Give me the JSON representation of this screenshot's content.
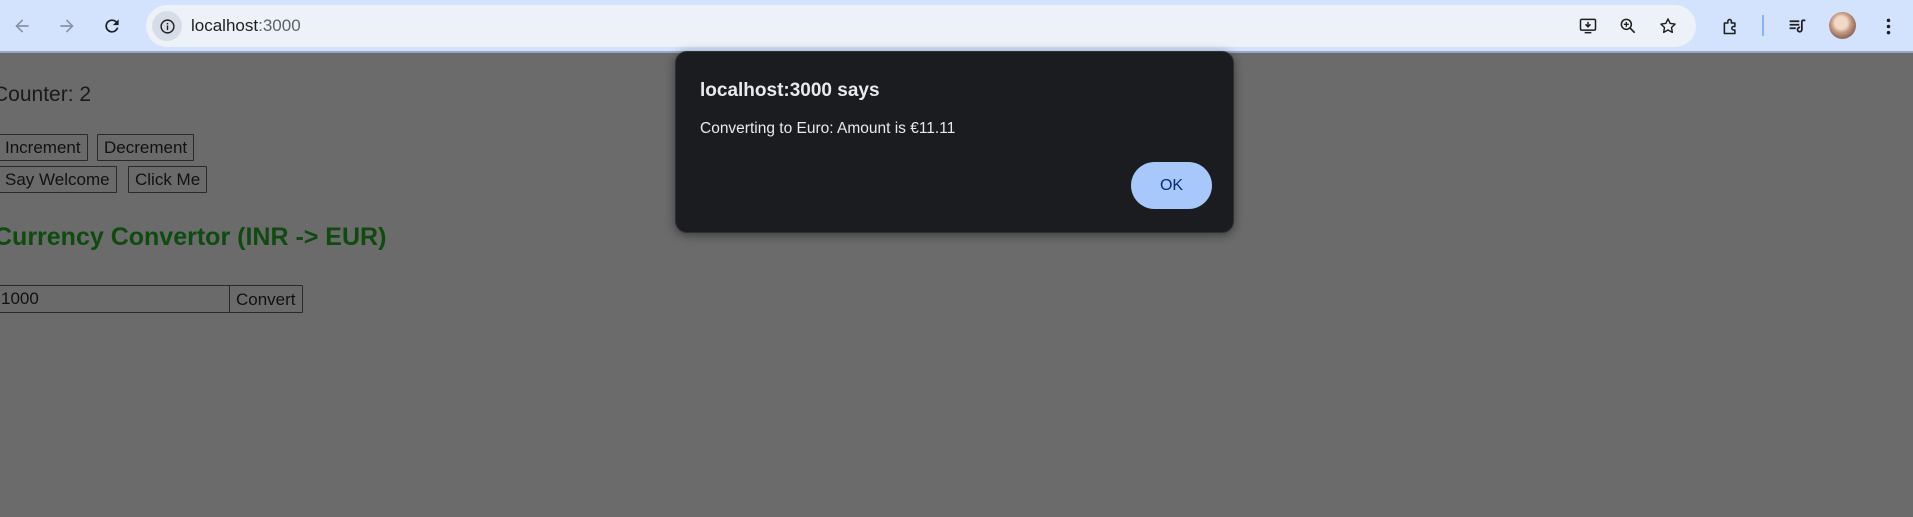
{
  "browser": {
    "url_host": "localhost",
    "url_port": ":3000"
  },
  "page": {
    "counter_text": "Counter: 2",
    "buttons": {
      "increment": "Increment",
      "decrement": "Decrement",
      "say_welcome": "Say Welcome",
      "click_me": "Click Me",
      "convert": "Convert"
    },
    "currency_heading": "Currency Convertor (INR -> EUR)",
    "amount_value": "1000"
  },
  "dialog": {
    "title": "localhost:3000 says",
    "message": "Converting to Euro: Amount is €11.11",
    "ok_label": "OK"
  },
  "colors": {
    "toolbar_bg": "#d3e3fd",
    "overlay_page_bg": "#6b6b6b",
    "dialog_bg": "#1b1c20",
    "ok_button_bg": "#a8c7fa",
    "heading_color": "#0f4a0f"
  },
  "icons": [
    "back-arrow-icon",
    "forward-arrow-icon",
    "reload-icon",
    "site-info-icon",
    "install-app-icon",
    "zoom-icon",
    "bookmark-star-icon",
    "extensions-icon",
    "media-queue-icon",
    "profile-avatar",
    "kebab-menu-icon"
  ]
}
